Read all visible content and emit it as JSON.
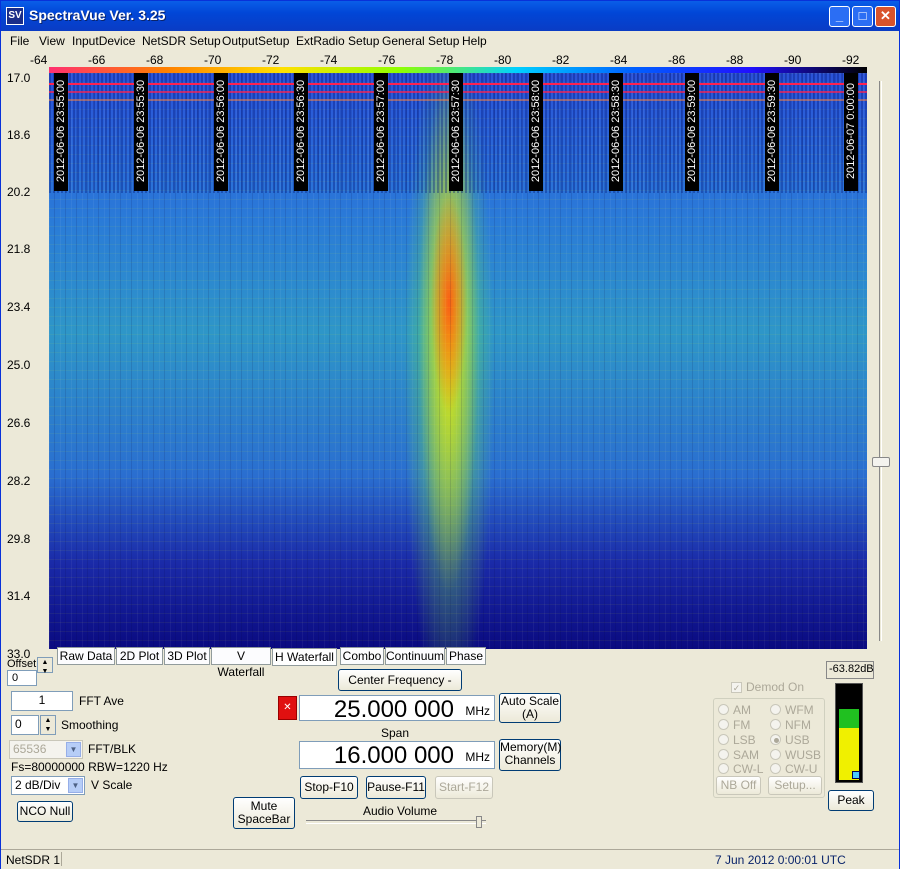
{
  "window": {
    "title": "SpectraVue Ver. 3.25",
    "icon": "SV"
  },
  "menu": [
    "File",
    "View",
    "InputDevice",
    "NetSDR Setup",
    "OutputSetup",
    "ExtRadio Setup",
    "General Setup",
    "Help"
  ],
  "freq_ticks": [
    "-64",
    "-66",
    "-68",
    "-70",
    "-72",
    "-74",
    "-76",
    "-78",
    "-80",
    "-82",
    "-84",
    "-86",
    "-88",
    "-90",
    "-92"
  ],
  "time_ticks": [
    "17.0",
    "18.6",
    "20.2",
    "21.8",
    "23.4",
    "25.0",
    "26.6",
    "28.2",
    "29.8",
    "31.4",
    "33.0"
  ],
  "timestamps": [
    "2012-06-06 23:55:00",
    "2012-06-06 23:55:30",
    "2012-06-06 23:56:00",
    "2012-06-06 23:56:30",
    "2012-06-06 23:57:00",
    "2012-06-06 23:57:30",
    "2012-06-06 23:58:00",
    "2012-06-06 23:58:30",
    "2012-06-06 23:59:00",
    "2012-06-06 23:59:30",
    "2012-06-07 0:00:00"
  ],
  "tabs": [
    "Raw Data",
    "2D Plot",
    "3D Plot",
    "V Waterfall",
    "H Waterfall",
    "Combo",
    "Continuum",
    "Phase"
  ],
  "active_tab": "H Waterfall",
  "offset": {
    "label": "Offset",
    "value": "0"
  },
  "fft_ave": {
    "value": "1",
    "label": "FFT Ave"
  },
  "smoothing": {
    "value": "0",
    "label": "Smoothing"
  },
  "fft_blk": {
    "value": "65536",
    "label": "FFT/BLK"
  },
  "fs_text": "Fs=80000000 RBW=1220 Hz",
  "vscale": {
    "value": "2 dB/Div",
    "label": "V Scale"
  },
  "buttons": {
    "nco_null": "NCO Null",
    "mute": "Mute SpaceBar",
    "center_freq": "Center Frequency - Ins",
    "auto_scale": "Auto Scale (A)",
    "memory": "Memory(M) Channels",
    "stop": "Stop-F10",
    "pause": "Pause-F11",
    "start": "Start-F12",
    "nb_off": "NB Off",
    "setup": "Setup...",
    "peak": "Peak"
  },
  "center_freq": {
    "value": "25.000 000",
    "unit": "MHz"
  },
  "span": {
    "label": "Span",
    "value": "16.000 000",
    "unit": "MHz"
  },
  "audio_volume": {
    "label": "Audio Volume",
    "level": 0.95
  },
  "demod": {
    "label": "Demod On",
    "checked": true,
    "modes": [
      "AM",
      "WFM",
      "FM",
      "NFM",
      "LSB",
      "USB",
      "SAM",
      "WUSB",
      "CW-L",
      "CW-U"
    ],
    "selected": "USB"
  },
  "level_readout": "-63.82dB",
  "level_meter": {
    "yellow_fraction": 0.55,
    "green_fraction": 0.2
  },
  "status": {
    "left": "NetSDR 1",
    "right": "7 Jun 2012  0:00:01 UTC"
  },
  "colors": {
    "title_bar": "#0146d7",
    "red_marker": "#e01010",
    "meter_yellow": "#f0f000",
    "meter_green": "#20c020"
  }
}
